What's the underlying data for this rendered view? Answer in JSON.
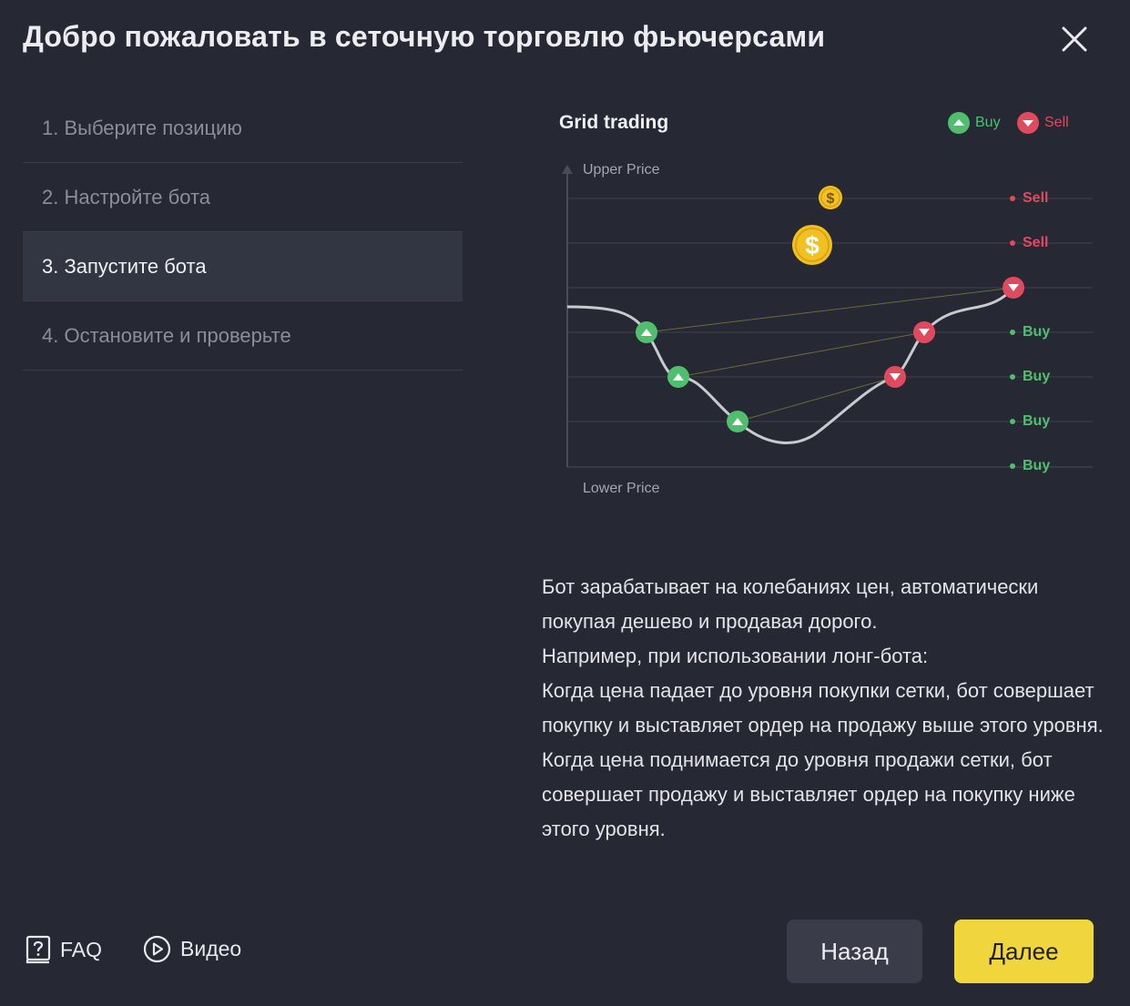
{
  "dialog": {
    "title": "Добро пожаловать в сеточную торговлю фьючерсами"
  },
  "steps": [
    {
      "label": "1. Выберите позицию"
    },
    {
      "label": "2. Настройте бота"
    },
    {
      "label": "3. Запустите бота"
    },
    {
      "label": "4. Остановите и проверьте"
    }
  ],
  "illustration": {
    "title": "Grid trading",
    "legend_buy": "Buy",
    "legend_sell": "Sell",
    "upper_price": "Upper Price",
    "lower_price": "Lower Price",
    "grid_levels": [
      "Sell",
      "Sell",
      "Buy",
      "Buy",
      "Buy",
      "Buy"
    ],
    "coin_symbol": "$",
    "colors": {
      "buy": "#4fbf6d",
      "sell": "#e04a5f",
      "coin": "#f2c023"
    }
  },
  "description": [
    "Бот зарабатывает на колебаниях цен, автоматически покупая дешево и продавая дорого.",
    "Например, при использовании лонг-бота:",
    "Когда цена падает до уровня покупки сетки, бот совершает покупку и выставляет ордер на продажу выше этого уровня.",
    "Когда цена поднимается до уровня продажи сетки, бот совершает продажу и выставляет ордер на покупку ниже этого уровня."
  ],
  "footer": {
    "faq_label": "FAQ",
    "video_label": "Видео",
    "back_label": "Назад",
    "next_label": "Далее"
  }
}
